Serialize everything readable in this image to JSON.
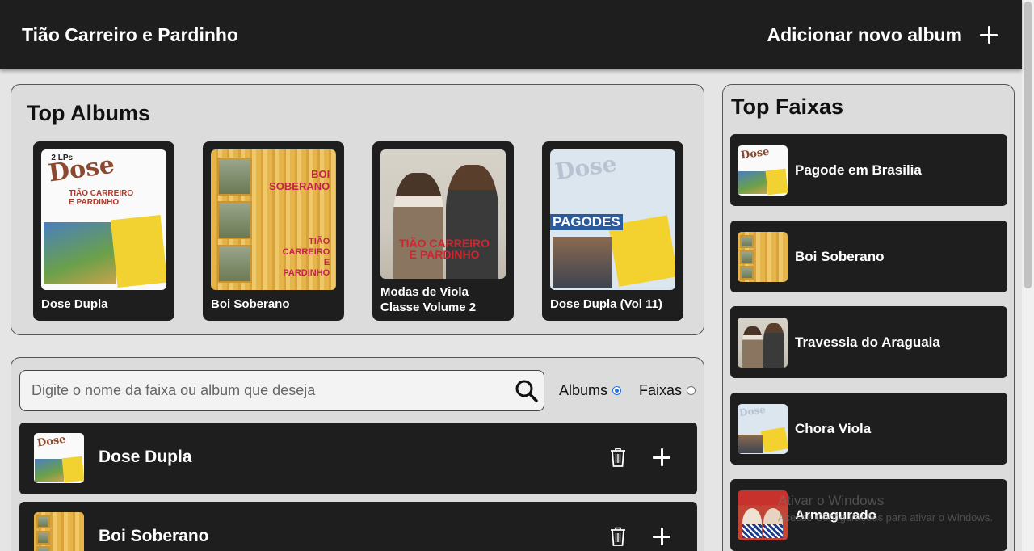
{
  "header": {
    "title": "Tião Carreiro e Pardinho",
    "add_album_label": "Adicionar novo album"
  },
  "top_albums": {
    "heading": "Top Albums",
    "items": [
      {
        "label": "Dose Dupla",
        "cover": "dose-dupla"
      },
      {
        "label": "Boi Soberano",
        "cover": "boi-soberano"
      },
      {
        "label": "Modas de Viola Classe Volume 2",
        "cover": "modas-de-viola"
      },
      {
        "label": "Dose Dupla (Vol 11)",
        "cover": "pagodes"
      }
    ]
  },
  "cover_text": {
    "dose": {
      "lps": "2 LPs",
      "title": "Dose",
      "names": "TIÃO CARREIRO\nE PARDINHO"
    },
    "boi": {
      "title": "BOI\nSOBERANO",
      "names": "TIÃO\nCARREIRO\nE\nPARDINHO"
    },
    "modas": {
      "names": "TIÃO CARREIRO\nE PARDINHO"
    },
    "pag": {
      "title": "Dose",
      "pagodes": "PAGODES"
    }
  },
  "search": {
    "placeholder": "Digite o nome da faixa ou album que deseja",
    "value": "",
    "options": [
      {
        "label": "Albums",
        "checked": true
      },
      {
        "label": "Faixas",
        "checked": false
      }
    ]
  },
  "results": [
    {
      "name": "Dose Dupla",
      "cover": "dose-dupla"
    },
    {
      "name": "Boi Soberano",
      "cover": "boi-soberano"
    }
  ],
  "top_tracks": {
    "heading": "Top Faixas",
    "items": [
      {
        "name": "Pagode em Brasilia",
        "cover": "dose-dupla"
      },
      {
        "name": "Boi Soberano",
        "cover": "boi-soberano"
      },
      {
        "name": "Travessia do Araguaia",
        "cover": "modas-de-viola"
      },
      {
        "name": "Chora Viola",
        "cover": "pagodes"
      },
      {
        "name": "Armagurado",
        "cover": "armagurado"
      }
    ]
  },
  "watermark": {
    "line1": "Ativar o Windows",
    "line2": "Acesse Configurações para ativar o Windows."
  },
  "colors": {
    "header_bg": "#1e1e1e",
    "page_bg": "#e5e5e5",
    "card_bg": "#1e1e1e",
    "radio_accent": "#1e6fd9"
  }
}
